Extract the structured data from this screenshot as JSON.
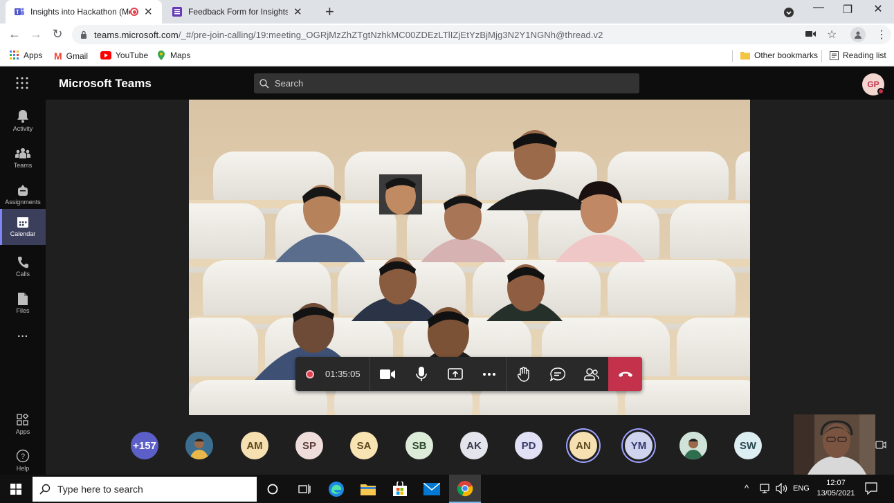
{
  "browser": {
    "tabs": [
      {
        "title": "Insights into Hackathon (Me",
        "active": true,
        "recording": true
      },
      {
        "title": "Feedback Form for Insights into I",
        "active": false
      }
    ],
    "url_host": "teams.microsoft.com",
    "url_path": "/_#/pre-join-calling/19:meeting_OGRjMzZhZTgtNzhkMC00ZDEzLTlIZjEtYzBjMjg3N2Y1NGNh@thread.v2",
    "bookmarks": [
      "Apps",
      "Gmail",
      "YouTube",
      "Maps"
    ],
    "other_bookmarks": "Other bookmarks",
    "reading_list": "Reading list"
  },
  "teams": {
    "app_title": "Microsoft Teams",
    "search_placeholder": "Search",
    "user_initials": "GP",
    "rail": [
      "Activity",
      "Teams",
      "Assignments",
      "Calendar",
      "Calls",
      "Files"
    ],
    "rail_active": "Calendar",
    "rail_bottom": [
      "Apps",
      "Help"
    ],
    "timer": "01:35:05",
    "participants": [
      {
        "label": "+157",
        "bg": "#5b5fc7",
        "fg": "#ffffff"
      },
      {
        "label": "",
        "bg": "#3b6e8f",
        "photo": true
      },
      {
        "label": "AM",
        "bg": "#f6dfb1",
        "fg": "#5c4a20"
      },
      {
        "label": "SP",
        "bg": "#eeddda",
        "fg": "#5a3e3a"
      },
      {
        "label": "SA",
        "bg": "#f8e3b3",
        "fg": "#5c4a20"
      },
      {
        "label": "SB",
        "bg": "#dcecd9",
        "fg": "#2f4a2c"
      },
      {
        "label": "AK",
        "bg": "#e4e4ec",
        "fg": "#3b3b4f"
      },
      {
        "label": "PD",
        "bg": "#e1e0f5",
        "fg": "#3b3a66"
      },
      {
        "label": "AN",
        "bg": "#f6dfb1",
        "fg": "#5c4a20",
        "ring": true
      },
      {
        "label": "YM",
        "bg": "#cfd3ee",
        "fg": "#33396b",
        "ring": true
      },
      {
        "label": "",
        "bg": "#cfe3d9",
        "photo": true
      },
      {
        "label": "SW",
        "bg": "#dceef2",
        "fg": "#2c4a52"
      }
    ]
  },
  "taskbar": {
    "search_placeholder": "Type here to search",
    "lang": "ENG",
    "time": "12:07",
    "date": "13/05/2021"
  },
  "colors": {
    "teams_accent": "#7f85f5",
    "hangup": "#c4314b",
    "record": "#e3404e"
  }
}
